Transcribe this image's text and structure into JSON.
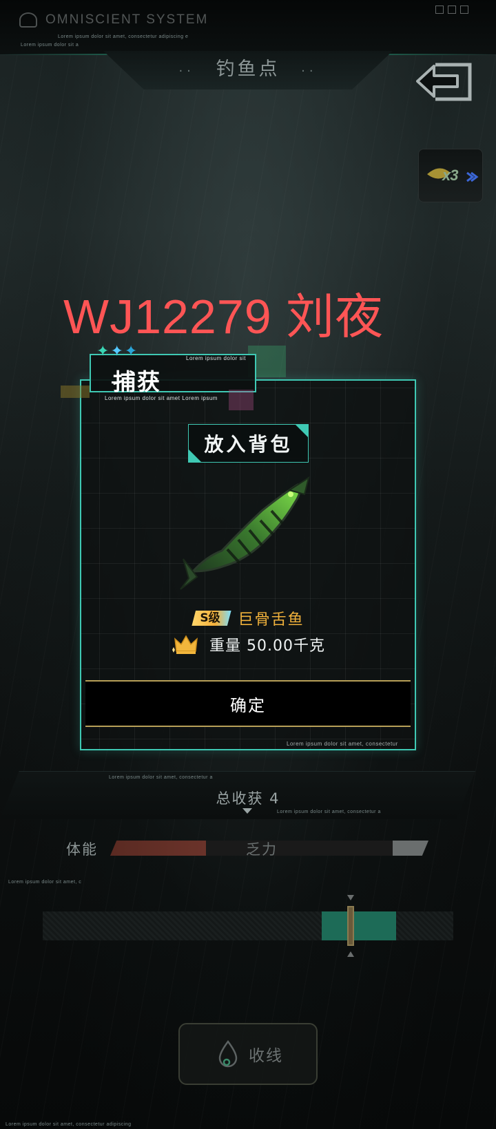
{
  "header": {
    "brand": "OMNISCIENT SYSTEM",
    "tagline_1": "Lorem ipsum dolor sit amet, consectetur adipiscing e",
    "tagline_2": "Lorem ipsum dolor sit a",
    "title": "钓鱼点",
    "title_dots": "··"
  },
  "multiplier": {
    "label": "x3"
  },
  "watermark": "WJ12279 刘夜",
  "capture_modal": {
    "title": "捕获",
    "stars": [
      "✦",
      "✦",
      "✦"
    ],
    "header_small_1": "Lorem ipsum dolor sit",
    "header_small_2": "Lorem ipsum dolor sit amet Lorem ipsum",
    "bag_label": "放入背包",
    "rank": "S级",
    "fish_name": "巨骨舌鱼",
    "weight": "重量 50.00千克",
    "confirm_label": "确定",
    "footer_small": "Lorem ipsum dolor sit amet, consectetur"
  },
  "hud": {
    "harvest_text": "总收获 4",
    "harvest_small_left": "Lorem ipsum dolor sit amet, consectetur a",
    "harvest_small_right": "Lorem ipsum dolor sit amet, consectetur a",
    "stamina_label": "体能",
    "stamina_state": "乏力",
    "stamina_level": 0.3,
    "divider_small": "Lorem ipsum dolor sit amet, c",
    "tension_zone_start": 0.68,
    "tension_zone_end": 0.86,
    "tension_marker": 0.75,
    "reel_label": "收线",
    "bottom_small": "Lorem ipsum dolor sit amet, consectetur adipiscing"
  },
  "colors": {
    "accent": "#3fc9b4",
    "rank_gold": "#f0b13b",
    "watermark": "#ff5555",
    "button_border": "#b8a058"
  }
}
